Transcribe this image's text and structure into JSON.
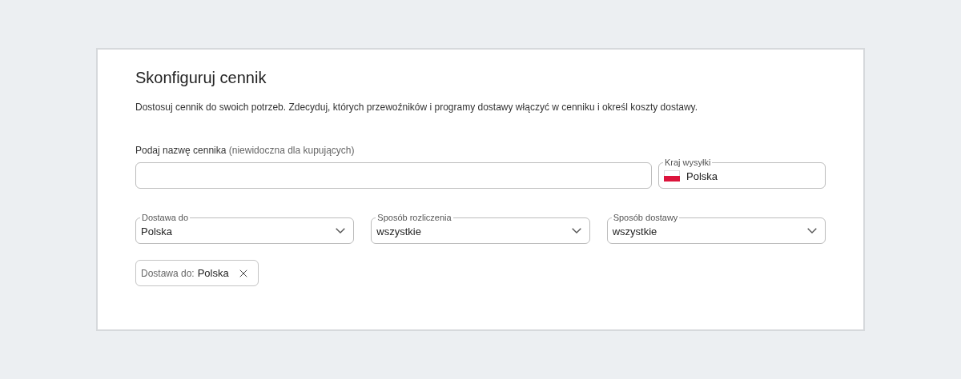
{
  "title": "Skonfiguruj cennik",
  "description": "Dostosuj cennik do swoich potrzeb. Zdecyduj, których przewoźników i programy dostawy włączyć w cenniku i określ koszty dostawy.",
  "name_field": {
    "label": "Podaj nazwę cennika",
    "hint": "(niewidoczna dla kupujących)"
  },
  "country_field": {
    "label": "Kraj wysyłki",
    "value": "Polska"
  },
  "selects": [
    {
      "label": "Dostawa do",
      "value": "Polska"
    },
    {
      "label": "Sposób rozliczenia",
      "value": "wszystkie"
    },
    {
      "label": "Sposób dostawy",
      "value": "wszystkie"
    }
  ],
  "chips": [
    {
      "label": "Dostawa do:",
      "value": "Polska"
    }
  ]
}
